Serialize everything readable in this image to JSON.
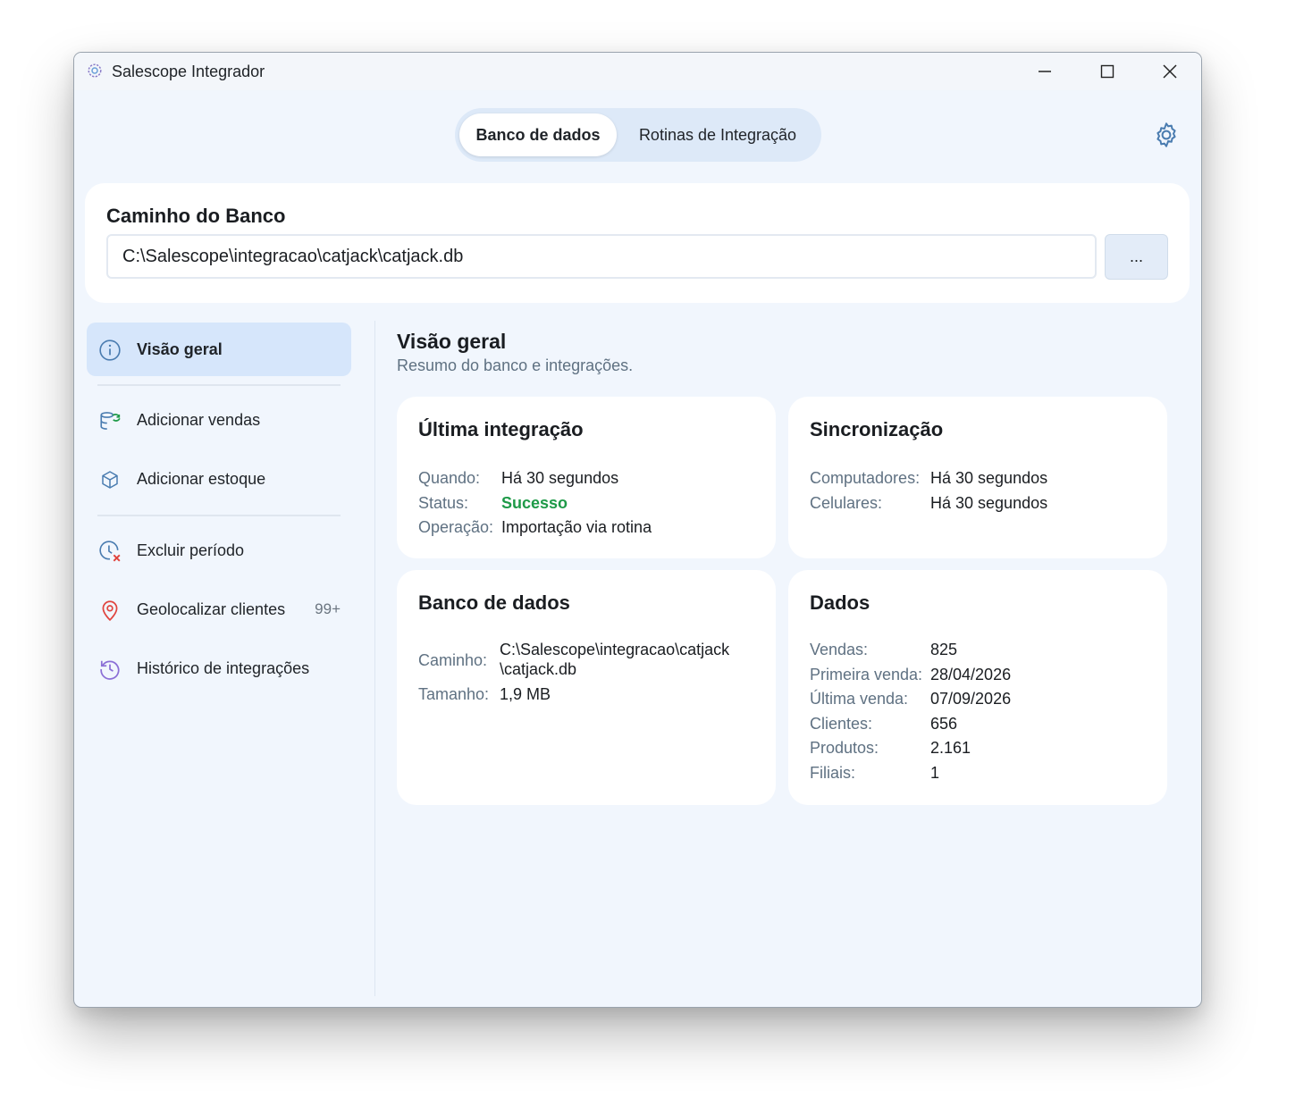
{
  "window": {
    "title": "Salescope Integrador"
  },
  "tabs": [
    {
      "label": "Banco de dados",
      "active": true
    },
    {
      "label": "Rotinas de Integração",
      "active": false
    }
  ],
  "path_section": {
    "title": "Caminho do Banco",
    "value": "C:\\Salescope\\integracao\\catjack\\catjack.db",
    "browse_label": "..."
  },
  "sidebar": {
    "items": [
      {
        "label": "Visão geral",
        "icon": "info-icon",
        "active": true
      },
      {
        "label": "Adicionar vendas",
        "icon": "database-sync-icon"
      },
      {
        "label": "Adicionar estoque",
        "icon": "box-icon"
      },
      {
        "label": "Excluir período",
        "icon": "clock-x-icon"
      },
      {
        "label": "Geolocalizar clientes",
        "icon": "map-pin-icon",
        "badge": "99+"
      },
      {
        "label": "Histórico de integrações",
        "icon": "history-icon"
      }
    ]
  },
  "content": {
    "title": "Visão geral",
    "subtitle": "Resumo do banco e integrações."
  },
  "cards": {
    "ultima": {
      "title": "Última integração",
      "rows": [
        {
          "k": "Quando:",
          "v": "Há 30 segundos"
        },
        {
          "k": "Status:",
          "v": "Sucesso"
        },
        {
          "k": "Operação:",
          "v": "Importação via rotina"
        }
      ]
    },
    "sync": {
      "title": "Sincronização",
      "rows": [
        {
          "k": "Computadores:",
          "v": "Há 30 segundos"
        },
        {
          "k": "Celulares:",
          "v": "Há 30 segundos"
        }
      ]
    },
    "banco": {
      "title": "Banco de dados",
      "caminho_k": "Caminho:",
      "caminho_v1": "C:\\Salescope\\integracao\\catjack",
      "caminho_v2": "\\catjack.db",
      "tamanho_k": "Tamanho:",
      "tamanho_v": "1,9 MB"
    },
    "dados": {
      "title": "Dados",
      "rows": [
        {
          "k": "Vendas:",
          "v": "825"
        },
        {
          "k": "Primeira venda:",
          "v": "28/04/2026"
        },
        {
          "k": "Última venda:",
          "v": "07/09/2026"
        },
        {
          "k": "Clientes:",
          "v": "656"
        },
        {
          "k": "Produtos:",
          "v": "2.161"
        },
        {
          "k": "Filiais:",
          "v": "1"
        }
      ]
    }
  },
  "colors": {
    "window_bg": "#f1f6fd",
    "accent": "#d6e6fb",
    "success": "#1e9a48",
    "muted": "#5f7182"
  }
}
